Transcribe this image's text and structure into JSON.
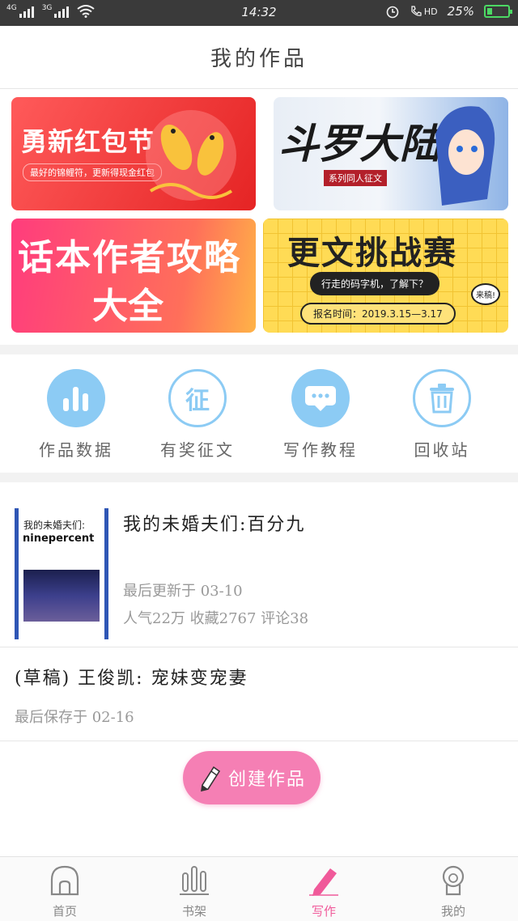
{
  "status_bar": {
    "network_1": "4G",
    "network_2": "3G",
    "time": "14:32",
    "hd": "HD",
    "battery": "25%"
  },
  "header": {
    "title": "我的作品"
  },
  "banners": {
    "b1": {
      "title": "勇新红包节",
      "subtitle": "最好的锦鲤符，更新得现金红包"
    },
    "b2": {
      "title": "斗罗大陆",
      "tag": "系列同人征文"
    },
    "b3": {
      "line1": "话本作者攻略",
      "line2": "大全"
    },
    "b4": {
      "title": "更文挑战赛",
      "pill": "行走的码字机，了解下？",
      "date": "报名时间：2019.3.15—3.17",
      "stamp": "来稿!"
    }
  },
  "tools": [
    {
      "label": "作品数据",
      "icon": "bar-chart-icon"
    },
    {
      "label": "有奖征文",
      "icon": "contest-icon",
      "glyph": "征"
    },
    {
      "label": "写作教程",
      "icon": "chat-bubble-icon"
    },
    {
      "label": "回收站",
      "icon": "trash-icon"
    }
  ],
  "works": [
    {
      "title": "我的未婚夫们:百分九",
      "cover_line1": "我的未婚夫们:",
      "cover_line2": "ninepercent",
      "updated": "最后更新于 03-10",
      "stats": "人气22万 收藏2767 评论38"
    },
    {
      "title": "(草稿) 王俊凯: 宠妹变宠妻",
      "saved": "最后保存于 02-16"
    }
  ],
  "create_button": {
    "label": "创建作品"
  },
  "tabbar": {
    "home": "首页",
    "shelf": "书架",
    "write": "写作",
    "mine": "我的"
  },
  "colors": {
    "accent": "#f05a9a",
    "tool_blue": "#8ccbf4",
    "create_pink": "#f57fb4"
  }
}
